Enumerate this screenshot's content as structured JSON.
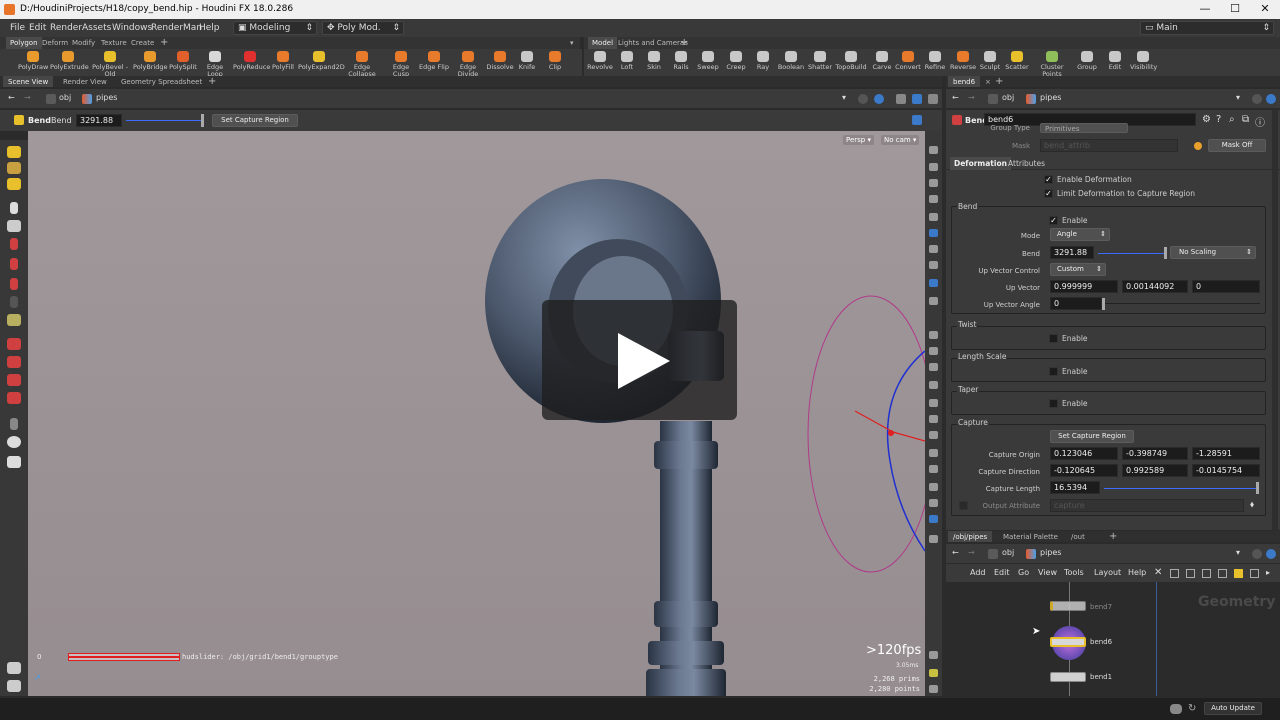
{
  "window": {
    "title": "D:/HoudiniProjects/H18/copy_bend.hip - Houdini FX 18.0.286",
    "min": "—",
    "max": "☐",
    "close": "✕"
  },
  "menu": {
    "items": [
      "File",
      "Edit",
      "Render",
      "Assets",
      "Windows",
      "RenderMan",
      "Help"
    ],
    "desktop": "Modeling",
    "polymod": "Poly Mod.",
    "main": "Main"
  },
  "shelf_left": {
    "tabs": [
      "Polygon",
      "Deform",
      "Modify",
      "Texture",
      "Create"
    ],
    "tools": [
      "PolyDraw",
      "PolyExtrude",
      "PolyBevel - Old",
      "PolyBridge",
      "PolySplit",
      "Edge Loop",
      "PolyReduce",
      "PolyFill",
      "PolyExpand2D",
      "Edge Collapse",
      "Edge Cusp",
      "Edge Flip",
      "Edge Divide",
      "Dissolve",
      "Knife",
      "Clip"
    ]
  },
  "shelf_right": {
    "tabs": [
      "Model",
      "Lights and Cameras"
    ],
    "tools": [
      "Revolve",
      "Loft",
      "Skin",
      "Rails",
      "Sweep",
      "Creep",
      "Ray",
      "Boolean",
      "Shatter",
      "TopoBuild",
      "Carve",
      "Convert",
      "Refine",
      "Reverse",
      "Sculpt",
      "Scatter",
      "Cluster Points",
      "Group",
      "Edit",
      "Visibility"
    ]
  },
  "viewer": {
    "tabs": [
      "Scene View",
      "Render View",
      "Geometry Spreadsheet"
    ],
    "path_obj": "obj",
    "path_geo": "pipes",
    "op_label": "Bend",
    "op_name": "Bend",
    "bend_value": "3291.88",
    "capture_button": "Set Capture Region",
    "persp": "Persp ▾",
    "cam": "No cam ▾",
    "fps": ">120fps",
    "ms": "3.05ms",
    "prims": "2,268   prims",
    "points": "2,280 points",
    "hud_zero": "0",
    "hud_text": "hudslider: /obj/grid1/bend1/grouptype",
    "play_color": "#1e1e1e"
  },
  "params": {
    "tab": "bend6",
    "path_obj": "obj",
    "path_geo": "pipes",
    "node_type": "Bend",
    "node_name": "bend6",
    "group_type_label": "Group Type",
    "group_type_value": "Primitives",
    "mask_label": "Mask",
    "mask_placeholder": "bend_attrib",
    "mask_button": "Mask Off",
    "tabs": [
      "Deformation",
      "Attributes"
    ],
    "enable_deformation": "Enable Deformation",
    "limit_deformation": "Limit Deformation to Capture Region",
    "bend_section": "Bend",
    "enable": "Enable",
    "mode_label": "Mode",
    "mode_value": "Angle",
    "bend_label": "Bend",
    "bend_value": "3291.88",
    "scaling": "No Scaling",
    "upvc_label": "Up Vector Control",
    "upvc_value": "Custom",
    "upv_label": "Up Vector",
    "upv": [
      "0.999999",
      "0.00144092",
      "0"
    ],
    "upva_label": "Up Vector Angle",
    "upva_value": "0",
    "twist": "Twist",
    "length_scale": "Length Scale",
    "taper": "Taper",
    "capture": "Capture",
    "set_capture": "Set Capture Region",
    "co_label": "Capture Origin",
    "co": [
      "0.123046",
      "-0.398749",
      "-1.28591"
    ],
    "cd_label": "Capture Direction",
    "cd": [
      "-0.120645",
      "0.992589",
      "-0.0145754"
    ],
    "cl_label": "Capture Length",
    "cl_value": "16.5394",
    "oa_label": "Output Attribute",
    "oa_placeholder": "capture"
  },
  "network": {
    "tabs": [
      "/obj/pipes",
      "Material Palette",
      "/out"
    ],
    "path_obj": "obj",
    "path_geo": "pipes",
    "menu": [
      "Add",
      "Edit",
      "Go",
      "View",
      "Tools",
      "Layout",
      "Help"
    ],
    "watermark": "Geometry",
    "nodes": [
      "bend7",
      "bend6",
      "bend1"
    ]
  },
  "status": {
    "auto_update": "Auto Update"
  }
}
